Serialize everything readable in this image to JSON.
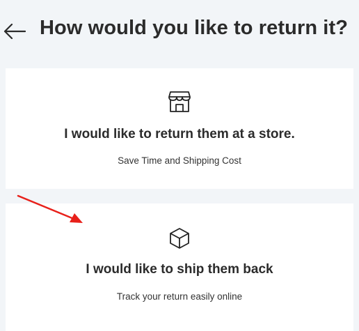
{
  "header": {
    "back_icon": "arrow-left-icon",
    "title": "How would you like to return it?"
  },
  "options": [
    {
      "icon": "storefront-icon",
      "title": "I would like to return them at a store.",
      "subtitle": "Save Time and Shipping Cost"
    },
    {
      "icon": "box-icon",
      "title": "I would like to ship them back",
      "subtitle": "Track your return easily online"
    }
  ],
  "colors": {
    "background": "#f2f5f8",
    "card": "#ffffff",
    "annotation_arrow": "#e8201a"
  }
}
